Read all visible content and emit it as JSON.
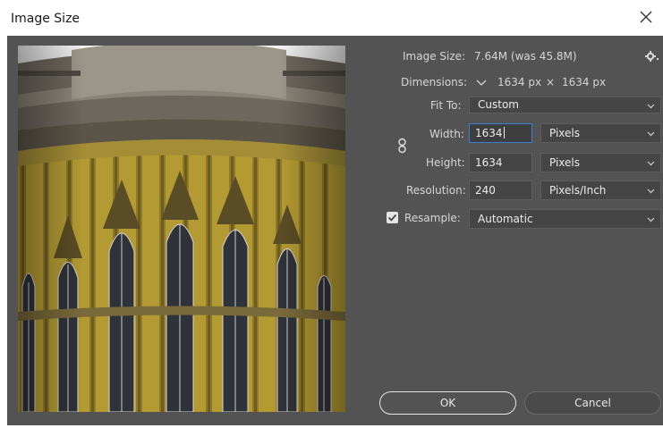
{
  "window": {
    "title": "Image Size"
  },
  "info": {
    "image_size_label": "Image Size:",
    "image_size_value": "7.64M (was 45.8M)",
    "dimensions_label": "Dimensions:",
    "dim_width": "1634 px",
    "dim_times": "×",
    "dim_height": "1634 px"
  },
  "fit_to": {
    "label": "Fit To:",
    "value": "Custom"
  },
  "width": {
    "label": "Width:",
    "value": "1634",
    "unit": "Pixels"
  },
  "height": {
    "label": "Height:",
    "value": "1634",
    "unit": "Pixels"
  },
  "resolution": {
    "label": "Resolution:",
    "value": "240",
    "unit": "Pixels/Inch"
  },
  "resample": {
    "label": "Resample:",
    "checked": true,
    "value": "Automatic"
  },
  "buttons": {
    "ok": "OK",
    "cancel": "Cancel"
  },
  "colors": {
    "panel": "#535353",
    "field": "#454545",
    "focus": "#3b7ed6",
    "stone": "#6d675e",
    "wall": "#b59a2f"
  }
}
